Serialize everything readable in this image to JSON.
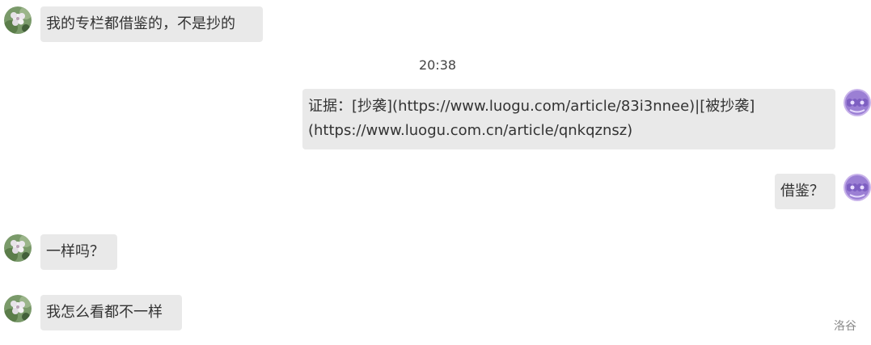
{
  "messages": [
    {
      "side": "left",
      "avatar_icon": "flower-avatar-icon",
      "text": "我的专栏都借鉴的，不是抄的"
    },
    {
      "type": "timestamp",
      "text": "20:38"
    },
    {
      "side": "right",
      "avatar_icon": "purple-avatar-icon",
      "lines": [
        "证据：[抄袭](https://www.luogu.com/article/83i3nnee)|[被抄袭]",
        "(https://www.luogu.com.cn/article/qnkqznsz)"
      ]
    },
    {
      "side": "right",
      "avatar_icon": "purple-avatar-icon",
      "text": "借鉴？"
    },
    {
      "side": "left",
      "avatar_icon": "flower-avatar-icon",
      "text": "一样吗？"
    },
    {
      "side": "left",
      "avatar_icon": "flower-avatar-icon",
      "text": "我怎么看都不一样"
    }
  ],
  "watermark": "洛谷",
  "colors": {
    "bubble_bg": "#e9e9e9",
    "text": "#333333",
    "watermark": "#8a8a8a"
  }
}
